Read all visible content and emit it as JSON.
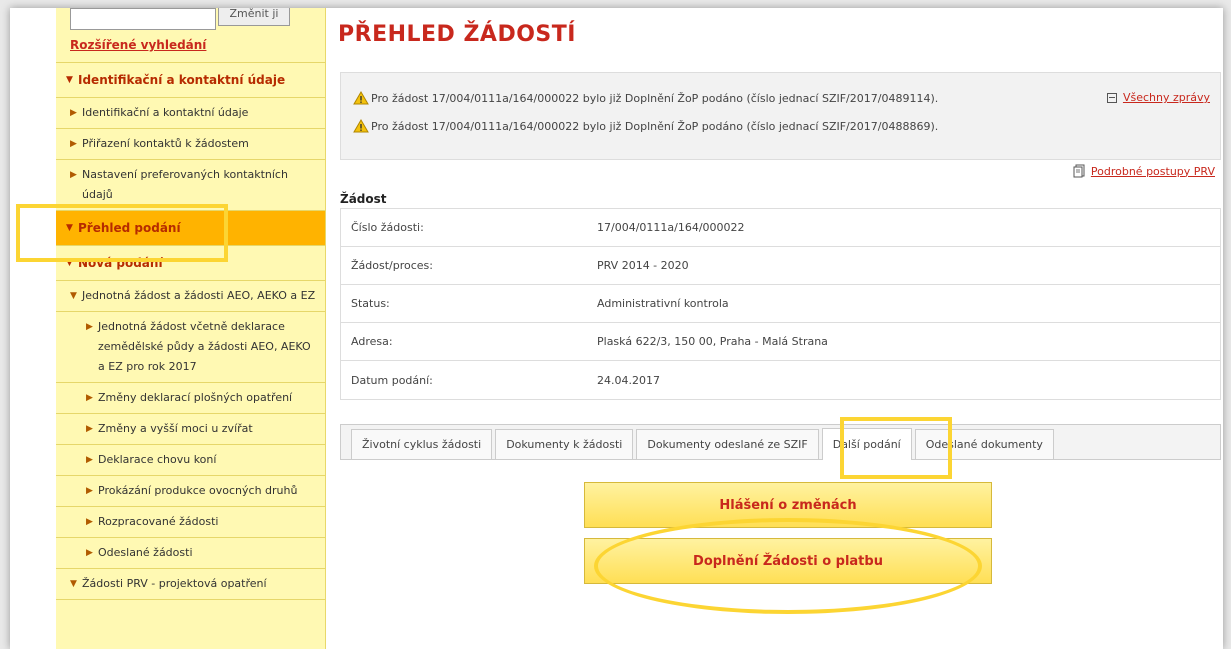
{
  "sidebar": {
    "search_button": "Změnit ji",
    "advanced_search": "Rozšířené vyhledání",
    "items": [
      {
        "label": "Identifikační a kontaktní údaje",
        "level": 0
      },
      {
        "label": "Identifikační a kontaktní údaje",
        "level": 1
      },
      {
        "label": "Přiřazení kontaktů k žádostem",
        "level": 1
      },
      {
        "label": "Nastavení preferovaných kontaktních údajů",
        "level": 1
      },
      {
        "label": "Přehled podání",
        "level": 0
      },
      {
        "label": "Nová podání",
        "level": 0
      },
      {
        "label": "Jednotná žádost a žádosti AEO, AEKO a EZ",
        "level": 2
      },
      {
        "label": "Jednotná žádost včetně deklarace zemědělské půdy a žádosti AEO, AEKO a EZ pro rok 2017",
        "level": 3
      },
      {
        "label": "Změny deklarací plošných opatření",
        "level": 3
      },
      {
        "label": "Změny a vyšší moci u zvířat",
        "level": 3
      },
      {
        "label": "Deklarace chovu koní",
        "level": 3
      },
      {
        "label": "Prokázání produkce ovocných druhů",
        "level": 3
      },
      {
        "label": "Rozpracované žádosti",
        "level": 3
      },
      {
        "label": "Odeslané žádosti",
        "level": 3
      },
      {
        "label": "Žádosti PRV - projektová opatření",
        "level": 2
      }
    ]
  },
  "main": {
    "title": "PŘEHLED ŽÁDOSTÍ",
    "messages": [
      "Pro žádost 17/004/0111a/164/000022 bylo již Doplnění ŽoP podáno (číslo jednací SZIF/2017/0489114).",
      "Pro žádost 17/004/0111a/164/000022 bylo již Doplnění ŽoP podáno (číslo jednací SZIF/2017/0488869)."
    ],
    "all_messages": "Všechny zprávy",
    "guide_link": "Podrobné postupy PRV",
    "section_title": "Žádost",
    "details": [
      {
        "label": "Číslo žádosti:",
        "value": "17/004/0111a/164/000022"
      },
      {
        "label": "Žádost/proces:",
        "value": "PRV 2014 - 2020"
      },
      {
        "label": "Status:",
        "value": "Administrativní kontrola"
      },
      {
        "label": "Adresa:",
        "value": "Plaská 622/3, 150 00, Praha - Malá Strana"
      },
      {
        "label": "Datum podání:",
        "value": "24.04.2017"
      }
    ],
    "tabs": [
      "Životní cyklus žádosti",
      "Dokumenty k žádosti",
      "Dokumenty odeslané ze SZIF",
      "Další podání",
      "Odeslané dokumenty"
    ],
    "active_tab": "Další podání",
    "buttons": [
      "Hlášení o změnách",
      "Doplnění Žádosti o platbu"
    ]
  },
  "colors": {
    "accent_red": "#c8281d",
    "sidebar_bg": "#fff9b3",
    "active_item": "#ffb300",
    "highlight": "#fcd533"
  }
}
